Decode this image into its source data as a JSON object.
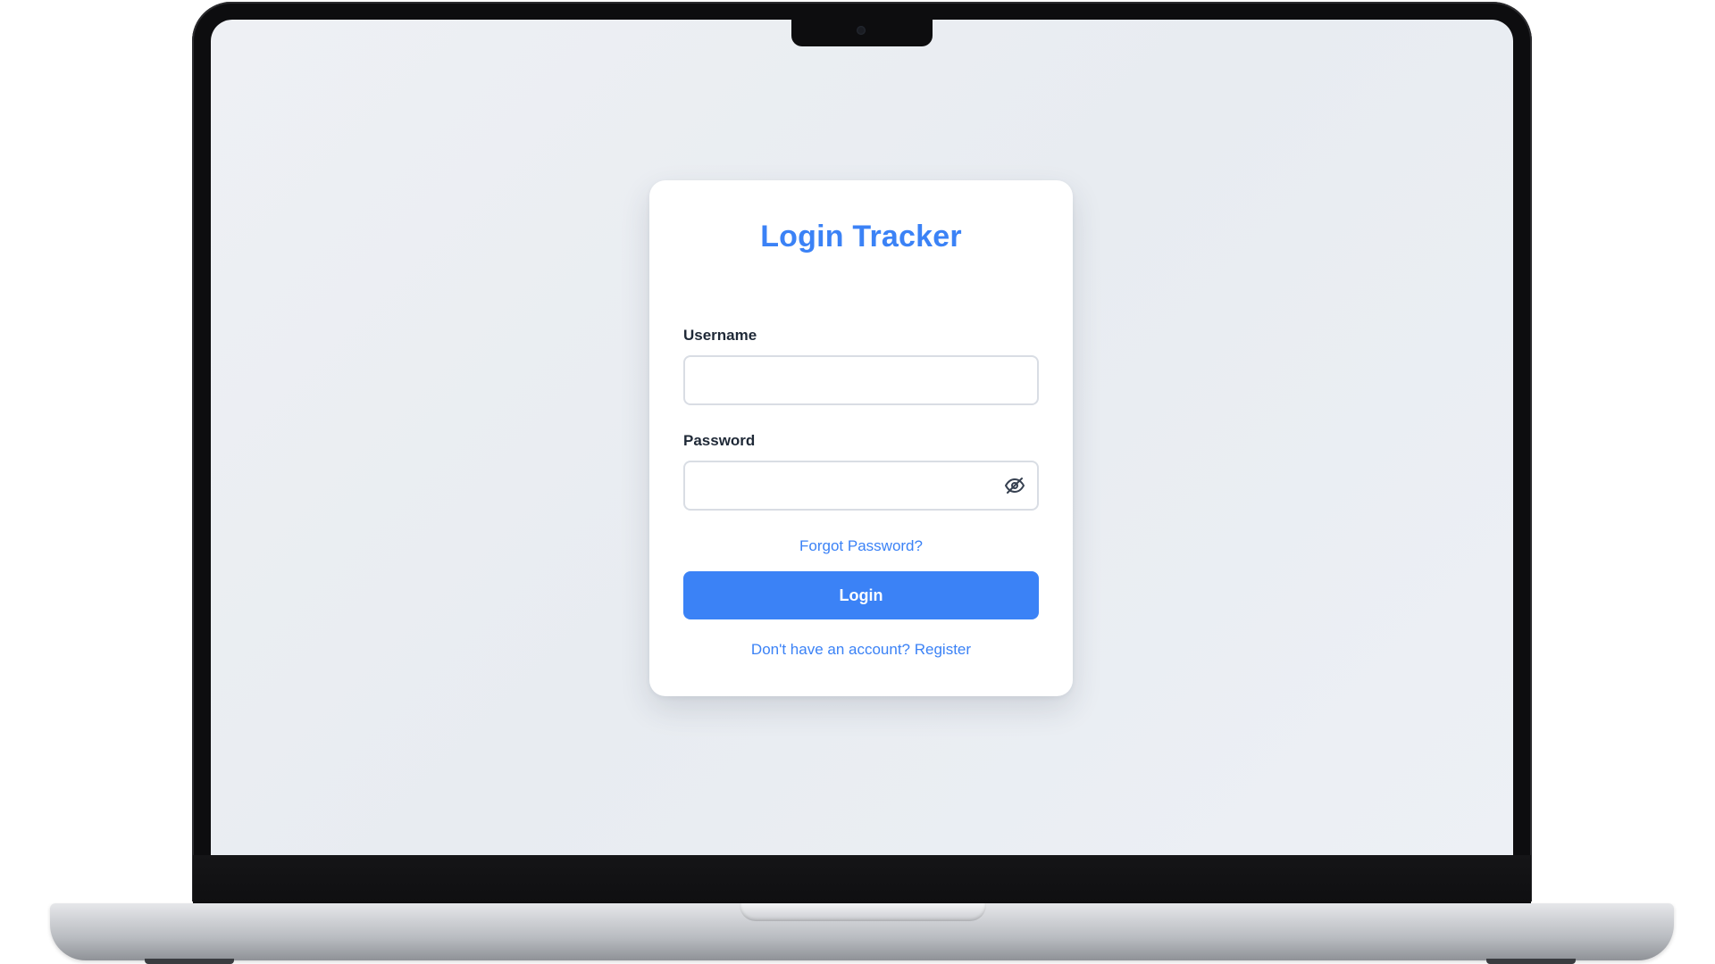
{
  "app": {
    "title": "Login Tracker"
  },
  "form": {
    "username_label": "Username",
    "username_value": "",
    "password_label": "Password",
    "password_value": "",
    "password_toggle_icon": "eye-off-icon",
    "forgot_password_link": "Forgot Password?",
    "login_button": "Login",
    "register_prompt": "Don't have an account?",
    "register_link": "Register"
  },
  "colors": {
    "accent": "#3b82f6",
    "background": "#eceff3",
    "card": "#ffffff",
    "label_text": "#1f2937",
    "input_border": "#d9dde4"
  }
}
